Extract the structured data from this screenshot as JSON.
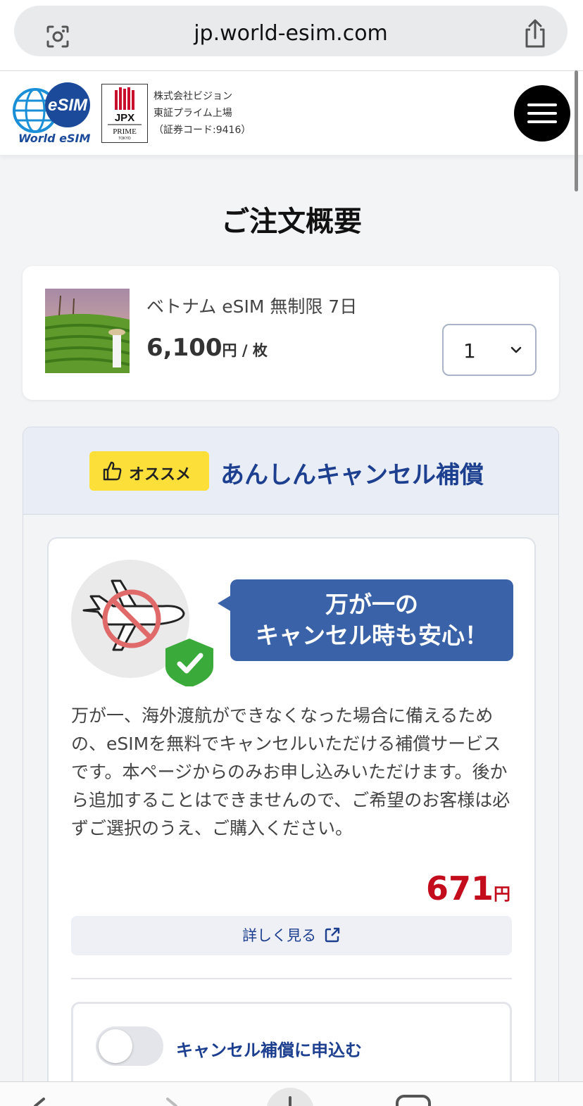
{
  "browser": {
    "url": "jp.world-esim.com"
  },
  "header": {
    "logo_text": "World eSIM",
    "logo_badge": "eSIM",
    "jpx_label": "JPX",
    "jpx_sub": "PRIME",
    "jpx_sub2": "TOKYO",
    "company_name": "株式会社ビジョン",
    "listing": "東証プライム上場",
    "stock_code": "（証券コード:9416）"
  },
  "page_title": "ご注文概要",
  "product": {
    "name": "ベトナム eSIM 無制限 7日",
    "price": "6,100",
    "currency": "円",
    "per_unit": " / 枚",
    "quantity": "1"
  },
  "cancel_protection": {
    "badge": "オススメ",
    "title": "あんしんキャンセル補償",
    "bubble_line1": "万が一の",
    "bubble_line2": "キャンセル時も安心！",
    "description": "万が一、海外渡航ができなくなった場合に備えるための、eSIMを無料でキャンセルいただける補償サービスです。本ページからのみお申し込みいただけます。後から追加することはできませんので、ご希望のお客様は必ずご選択のうえ、ご購入ください。",
    "price": "671",
    "currency": "円",
    "details_link": "詳しく見る",
    "apply_label": "キャンセル補償に申込む",
    "apply_enabled": false
  },
  "colors": {
    "brand_blue": "#1c3f8f",
    "bubble_blue": "#3a62a8",
    "badge_yellow": "#fddf3a",
    "price_red": "#c30d1d"
  }
}
